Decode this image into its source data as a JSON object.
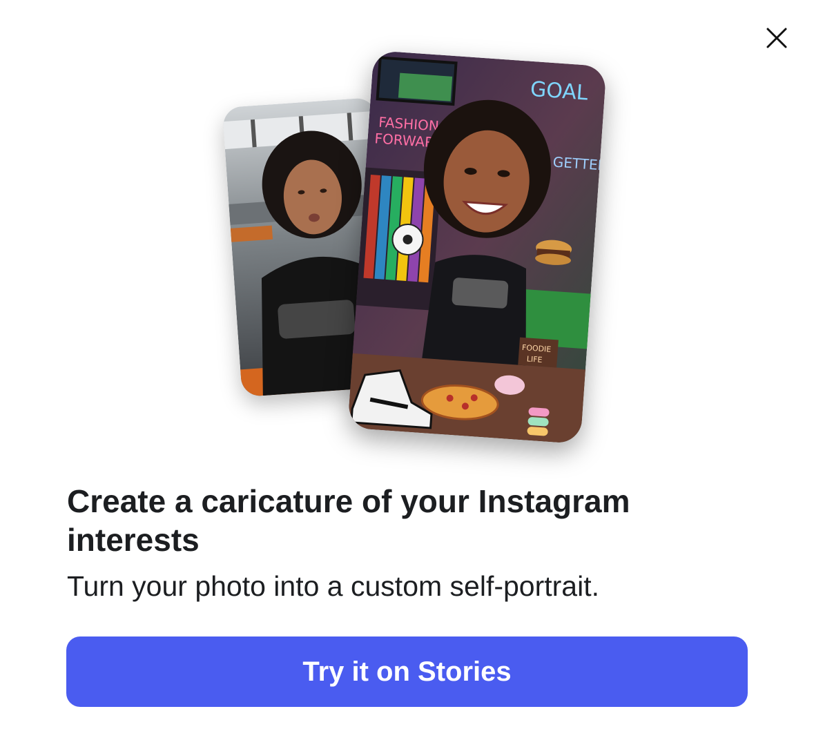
{
  "dialog": {
    "title": "Create a caricature of your Instagram interests",
    "subtitle": "Turn your photo into a custom self-portrait.",
    "cta_label": "Try it on Stories",
    "close_icon": "close-icon"
  },
  "preview": {
    "back_card": "selfie-photo",
    "front_card": "caricature-illustration",
    "signs": [
      "FASHION FORWARD",
      "GOAL",
      "GETTER",
      "FOODIE LIFE"
    ]
  },
  "colors": {
    "cta_background": "#4a5cf0",
    "cta_text": "#ffffff",
    "text_primary": "#1c1e21"
  }
}
